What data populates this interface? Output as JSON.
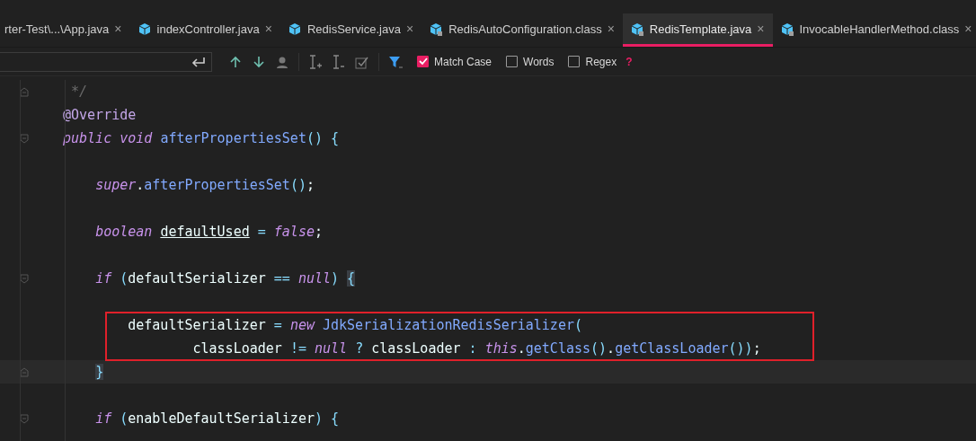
{
  "tabs": [
    {
      "label": "rter-Test\\...\\App.java",
      "icon": false,
      "selected": false
    },
    {
      "label": "indexController.java",
      "icon": true,
      "badge": false,
      "selected": false
    },
    {
      "label": "RedisService.java",
      "icon": true,
      "badge": false,
      "selected": false
    },
    {
      "label": "RedisAutoConfiguration.class",
      "icon": true,
      "badge": true,
      "selected": false
    },
    {
      "label": "RedisTemplate.java",
      "icon": true,
      "badge": true,
      "selected": true
    },
    {
      "label": "InvocableHandlerMethod.class",
      "icon": true,
      "badge": true,
      "selected": false
    }
  ],
  "tab_close": "×",
  "search": {
    "options": [
      {
        "label": "Match Case",
        "checked": true
      },
      {
        "label": "Words",
        "checked": false
      },
      {
        "label": "Regex",
        "checked": false
      }
    ],
    "help": "?"
  },
  "code": [
    {
      "kind": "code",
      "fold_end": true,
      "tokens": [
        {
          "kind": "comment",
          "text": " */"
        }
      ]
    },
    {
      "kind": "code",
      "tokens": [
        {
          "kind": "annotation",
          "text": "@Override"
        }
      ]
    },
    {
      "kind": "code",
      "fold_start": true,
      "tokens": [
        {
          "kind": "keyword",
          "text": "public"
        },
        {
          "kind": "keyword",
          "text": " void"
        },
        {
          "kind": "method",
          "text": " afterPropertiesSet"
        },
        {
          "kind": "paren",
          "text": "() {"
        }
      ]
    },
    {
      "kind": "blank"
    },
    {
      "kind": "code",
      "tokens": [
        {
          "kind": "keyword",
          "text": "    super"
        },
        {
          "kind": "plain",
          "text": "."
        },
        {
          "kind": "method",
          "text": "afterPropertiesSet"
        },
        {
          "kind": "paren",
          "text": "()"
        },
        {
          "kind": "plain",
          "text": ";"
        }
      ]
    },
    {
      "kind": "blank"
    },
    {
      "kind": "code",
      "tokens": [
        {
          "kind": "keyword",
          "text": "    boolean"
        },
        {
          "kind": "underline",
          "text": " defaultUsed"
        },
        {
          "kind": "paren",
          "text": " = "
        },
        {
          "kind": "keyword",
          "text": "false"
        },
        {
          "kind": "plain",
          "text": ";"
        }
      ]
    },
    {
      "kind": "blank"
    },
    {
      "kind": "code",
      "fold_start": true,
      "tokens": [
        {
          "kind": "keyword",
          "text": "    if"
        },
        {
          "kind": "paren",
          "text": " ("
        },
        {
          "kind": "plain",
          "text": "defaultSerializer"
        },
        {
          "kind": "paren",
          "text": " == "
        },
        {
          "kind": "keyword",
          "text": "null"
        },
        {
          "kind": "paren",
          "text": ") "
        },
        {
          "kind": "match",
          "text": "{"
        }
      ]
    },
    {
      "kind": "blank"
    },
    {
      "kind": "boxed",
      "tokens": [
        {
          "kind": "plain",
          "text": "        defaultSerializer"
        },
        {
          "kind": "paren",
          "text": " = "
        },
        {
          "kind": "keyword",
          "text": "new"
        },
        {
          "kind": "method",
          "text": " JdkSerializationRedisSerializer"
        },
        {
          "kind": "paren",
          "text": "("
        }
      ]
    },
    {
      "kind": "boxed",
      "tokens": [
        {
          "kind": "plain",
          "text": "                classLoader"
        },
        {
          "kind": "paren",
          "text": " != "
        },
        {
          "kind": "keyword",
          "text": "null"
        },
        {
          "kind": "paren",
          "text": " ? "
        },
        {
          "kind": "plain",
          "text": "classLoader"
        },
        {
          "kind": "paren",
          "text": " : "
        },
        {
          "kind": "keyword",
          "text": "this"
        },
        {
          "kind": "plain",
          "text": "."
        },
        {
          "kind": "method",
          "text": "getClass"
        },
        {
          "kind": "paren",
          "text": "()"
        },
        {
          "kind": "plain",
          "text": "."
        },
        {
          "kind": "method",
          "text": "getClassLoader"
        },
        {
          "kind": "paren",
          "text": "())"
        },
        {
          "kind": "plain",
          "text": ";"
        }
      ]
    },
    {
      "kind": "current",
      "fold_end": true,
      "tokens": [
        {
          "kind": "match",
          "text": "    }"
        }
      ]
    },
    {
      "kind": "blank"
    },
    {
      "kind": "code",
      "fold_start": true,
      "tokens": [
        {
          "kind": "keyword",
          "text": "    if"
        },
        {
          "kind": "paren",
          "text": " ("
        },
        {
          "kind": "plain",
          "text": "enableDefaultSerializer"
        },
        {
          "kind": "paren",
          "text": ") {"
        }
      ]
    }
  ]
}
